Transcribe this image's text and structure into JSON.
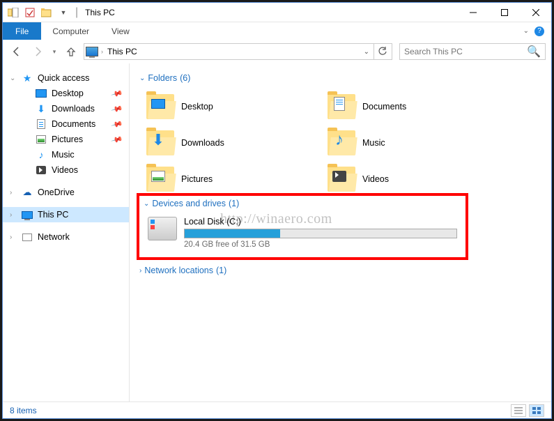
{
  "window": {
    "title": "This PC"
  },
  "ribbon": {
    "file": "File",
    "computer": "Computer",
    "view": "View"
  },
  "address": {
    "location": "This PC",
    "search_placeholder": "Search This PC"
  },
  "navpane": {
    "quick_access": "Quick access",
    "items": [
      {
        "label": "Desktop"
      },
      {
        "label": "Downloads"
      },
      {
        "label": "Documents"
      },
      {
        "label": "Pictures"
      },
      {
        "label": "Music"
      },
      {
        "label": "Videos"
      }
    ],
    "onedrive": "OneDrive",
    "this_pc": "This PC",
    "network": "Network"
  },
  "sections": {
    "folders": {
      "label": "Folders",
      "count": "(6)"
    },
    "drives": {
      "label": "Devices and drives",
      "count": "(1)"
    },
    "netloc": {
      "label": "Network locations",
      "count": "(1)"
    }
  },
  "folders": [
    {
      "label": "Desktop"
    },
    {
      "label": "Documents"
    },
    {
      "label": "Downloads"
    },
    {
      "label": "Music"
    },
    {
      "label": "Pictures"
    },
    {
      "label": "Videos"
    }
  ],
  "drive": {
    "name": "Local Disk (C:)",
    "free_text": "20.4 GB free of 31.5 GB",
    "used_percent": 35
  },
  "watermark": "http://winaero.com",
  "status": {
    "items": "8 items"
  }
}
